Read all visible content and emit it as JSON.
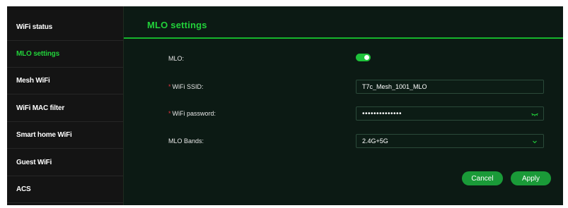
{
  "sidebar": {
    "items": [
      {
        "label": "WiFi status",
        "active": false
      },
      {
        "label": "MLO settings",
        "active": true
      },
      {
        "label": "Mesh WiFi",
        "active": false
      },
      {
        "label": "WiFi MAC filter",
        "active": false
      },
      {
        "label": "Smart home WiFi",
        "active": false
      },
      {
        "label": "Guest WiFi",
        "active": false
      },
      {
        "label": "ACS",
        "active": false
      }
    ]
  },
  "main": {
    "title": "MLO settings",
    "mlo": {
      "label": "MLO:",
      "enabled": true
    },
    "ssid": {
      "required_mark": "*",
      "label": "WiFi SSID:",
      "value": "T7c_Mesh_1001_MLO"
    },
    "password": {
      "required_mark": "*",
      "label": "WiFi password:",
      "masked_value": "••••••••••••••",
      "icon": "eye-hidden-icon"
    },
    "bands": {
      "label": "MLO Bands:",
      "selected": "2.4G+5G",
      "icon": "chevron-down-icon"
    },
    "cancel_label": "Cancel",
    "apply_label": "Apply"
  },
  "colors": {
    "accent": "#22d13a",
    "button": "#1a9a38",
    "panel_bg": "#0c1a14",
    "sidebar_bg": "#141414",
    "required": "#e8323c"
  }
}
